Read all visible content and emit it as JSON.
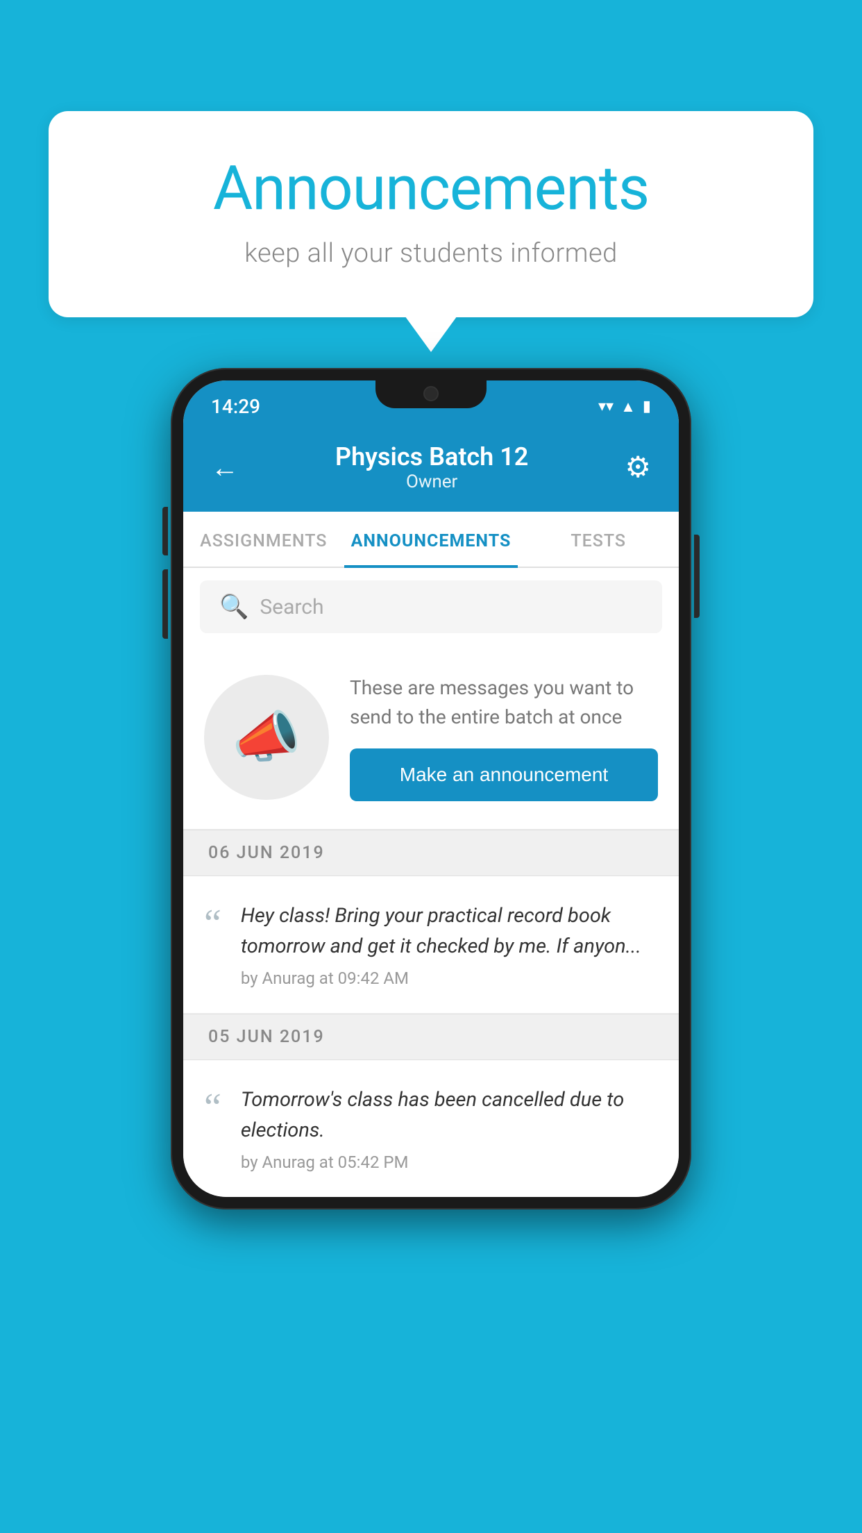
{
  "page": {
    "background_color": "#17b3d9"
  },
  "speech_bubble": {
    "title": "Announcements",
    "subtitle": "keep all your students informed"
  },
  "phone": {
    "status_bar": {
      "time": "14:29",
      "wifi": "▼",
      "signal": "◀",
      "battery": "▮"
    },
    "header": {
      "back_label": "←",
      "title": "Physics Batch 12",
      "subtitle": "Owner",
      "gear_label": "⚙"
    },
    "tabs": [
      {
        "label": "ASSIGNMENTS",
        "active": false
      },
      {
        "label": "ANNOUNCEMENTS",
        "active": true
      },
      {
        "label": "TESTS",
        "active": false
      }
    ],
    "search": {
      "placeholder": "Search"
    },
    "announcement_prompt": {
      "description": "These are messages you want to send to the entire batch at once",
      "button_label": "Make an announcement"
    },
    "dates": [
      {
        "date_label": "06  JUN  2019",
        "announcements": [
          {
            "text": "Hey class! Bring your practical record book tomorrow and get it checked by me. If anyon...",
            "meta": "by Anurag at 09:42 AM"
          }
        ]
      },
      {
        "date_label": "05  JUN  2019",
        "announcements": [
          {
            "text": "Tomorrow's class has been cancelled due to elections.",
            "meta": "by Anurag at 05:42 PM"
          }
        ]
      }
    ]
  }
}
